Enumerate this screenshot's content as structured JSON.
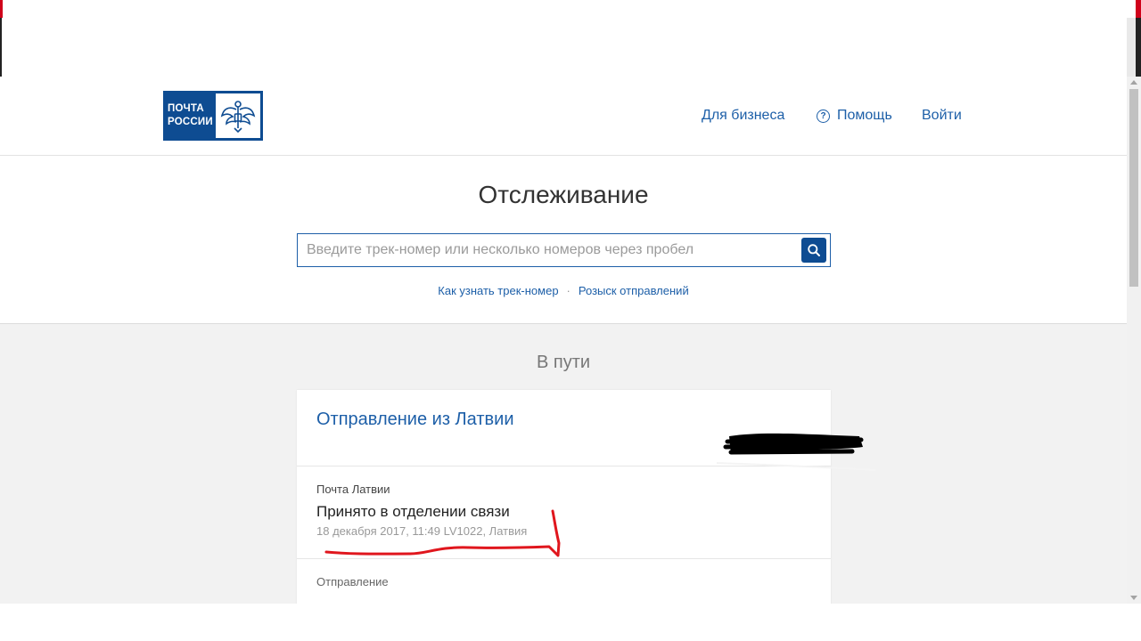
{
  "logo": {
    "line1": "ПОЧТА",
    "line2": "РОССИИ"
  },
  "nav": {
    "business": "Для бизнеса",
    "help": "Помощь",
    "login": "Войти"
  },
  "tracking": {
    "title": "Отслеживание",
    "search_placeholder": "Введите трек-номер или несколько номеров через пробел",
    "links": {
      "how_to_find": "Как узнать трек-номер",
      "separator": "·",
      "search_shipments": "Розыск отправлений"
    }
  },
  "status": {
    "title": "В пути"
  },
  "card": {
    "title": "Отправление из Латвии",
    "operator": "Почта Латвии",
    "event": "Принято в отделении связи",
    "event_meta": "18 декабря 2017, 11:49 LV1022, Латвия",
    "section_label": "Отправление"
  },
  "colors": {
    "brand_blue": "#0e4c92",
    "link_blue": "#1d5fa8",
    "annotation_red": "#e0161d"
  }
}
